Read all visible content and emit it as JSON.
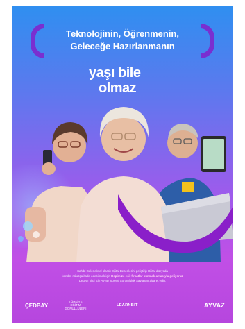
{
  "headline": {
    "line1": "Teknolojinin, Öğrenmenin,",
    "line2": "Geleceğe Hazırlanmanın"
  },
  "logo": {
    "word1": "yaşı bile",
    "word2": "olmaz"
  },
  "body_copy": {
    "line1": "Sahibi Geleneksel olarak Dijital Becerilerini geliştirip Dijital dünyada",
    "line2_pre": "kendini rahatça ifade edebilmek için",
    "line2_highlight": "Hepimize eşit fırsatlar sunmak amacıyla geliyoruz",
    "line3": "Detaylı bilgi için Ayvaz Sosyal Sorumluluk Sayfasını ziyaret edin."
  },
  "partners": {
    "p1": "ÇEDBAY",
    "p2": "TÜRKİYE EĞİTİM GÖNÜLLÜLERİ",
    "p3": "LEARNBIT",
    "p4": "AYVAZ"
  },
  "colors": {
    "gradient_top": "#2f8ff0",
    "gradient_bottom": "#c14fe6",
    "accent_purple": "#7a2fd0",
    "arc_purple": "#8a1fc9"
  }
}
